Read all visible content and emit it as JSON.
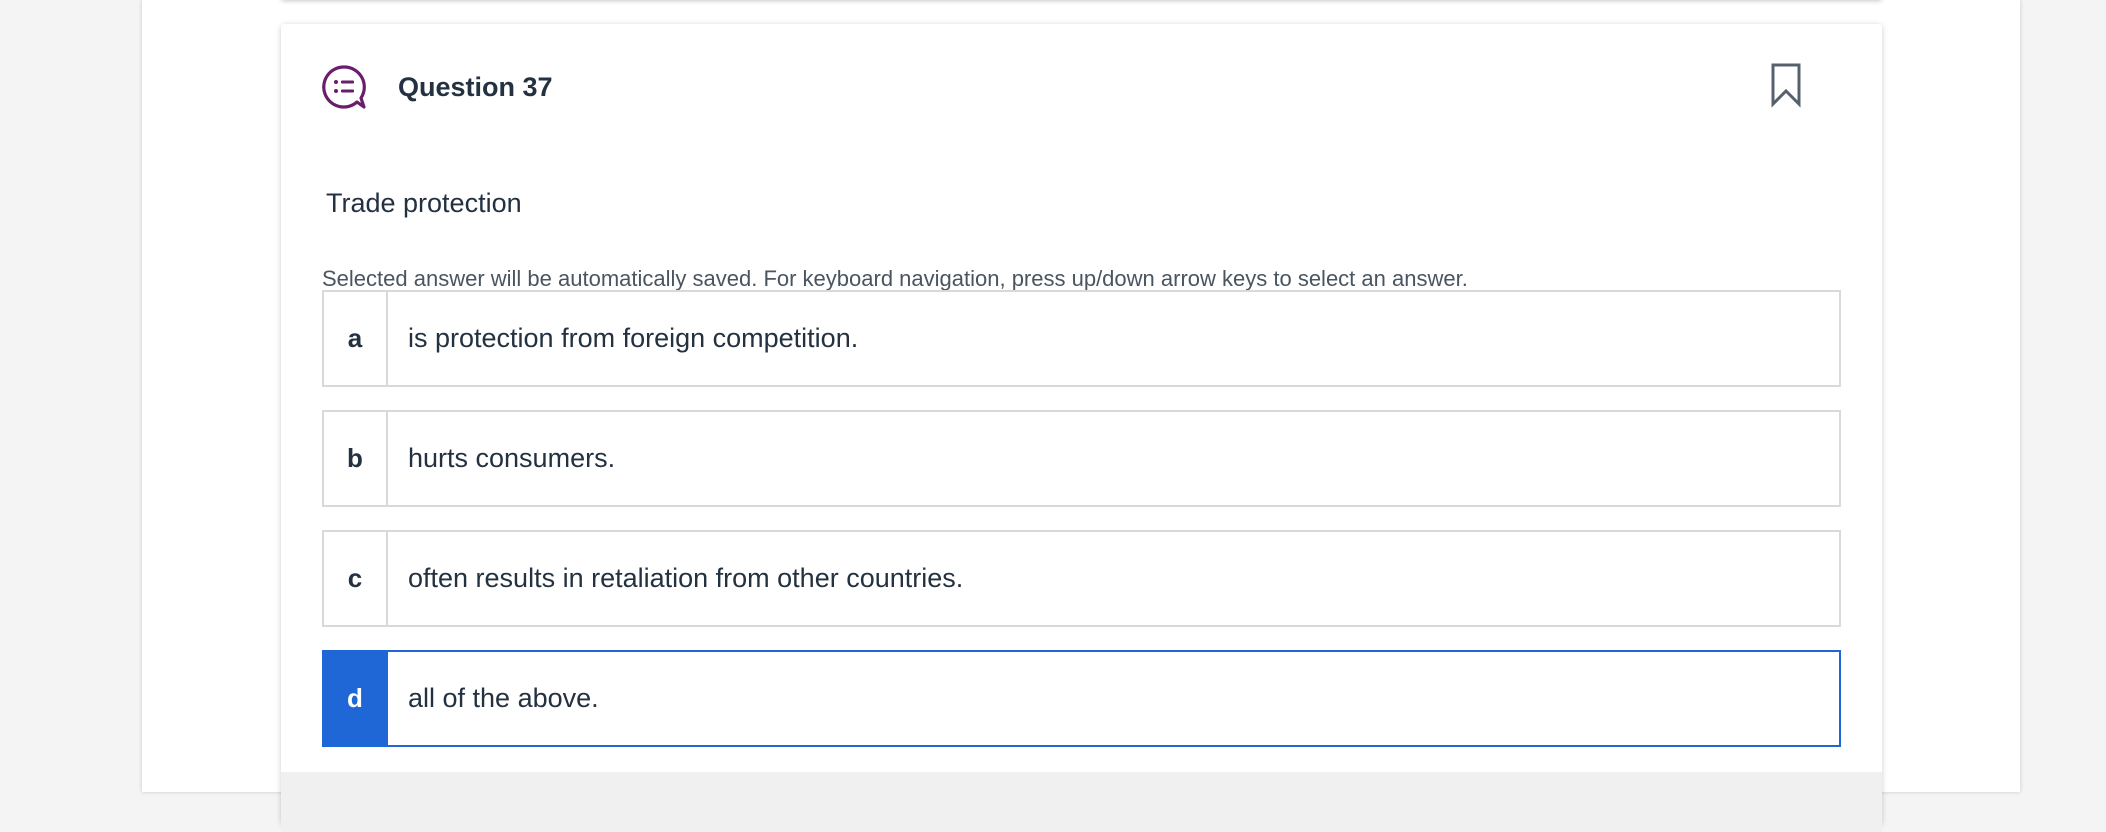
{
  "question": {
    "title": "Question 37",
    "stem": "Trade protection",
    "instructions": "Selected answer will be automatically saved. For keyboard navigation, press up/down arrow keys to select an answer.",
    "icon": "multiple-choice-chat-icon",
    "bookmark_icon": "bookmark-icon",
    "selected": "d",
    "answers": [
      {
        "letter": "a",
        "text": "is protection from foreign competition."
      },
      {
        "letter": "b",
        "text": "hurts consumers."
      },
      {
        "letter": "c",
        "text": "often results in retaliation from other countries."
      },
      {
        "letter": "d",
        "text": "all of the above."
      }
    ]
  },
  "colors": {
    "accent": "#1f66d6",
    "icon": "#6b1d6b",
    "text": "#233140",
    "border": "#d9d9d9"
  }
}
